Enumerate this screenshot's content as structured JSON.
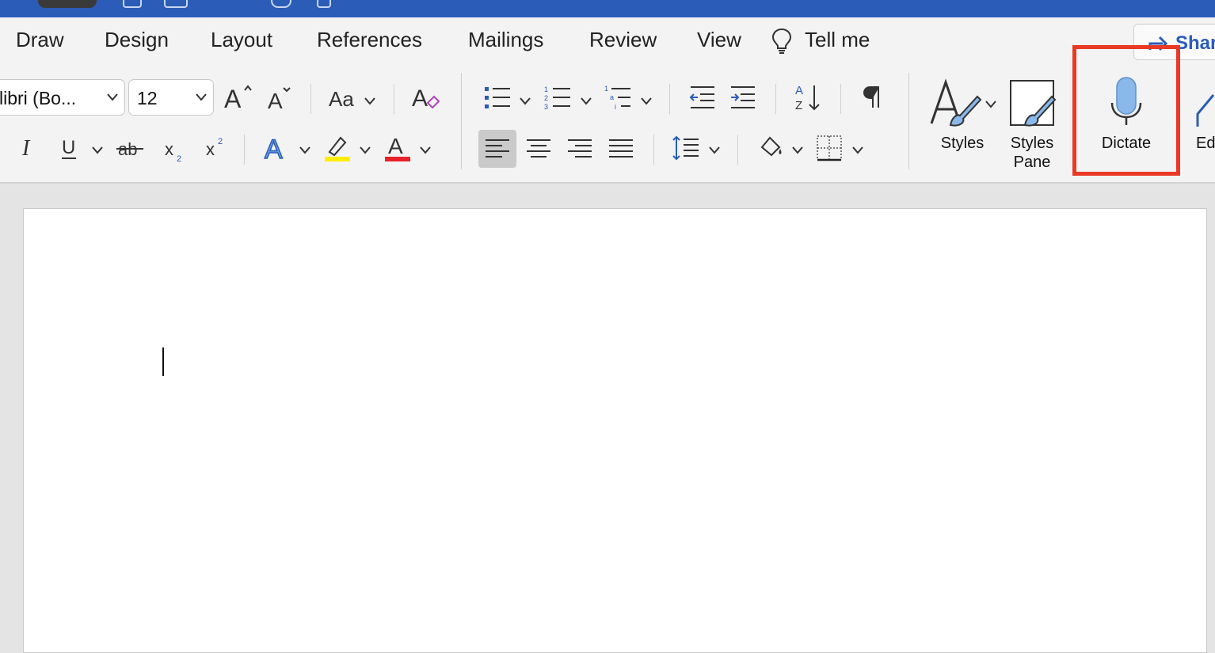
{
  "tabs": [
    "Draw",
    "Design",
    "Layout",
    "References",
    "Mailings",
    "Review",
    "View"
  ],
  "tell_me": {
    "label": "Tell me",
    "icon": "lightbulb-icon"
  },
  "share": {
    "label": "Shar",
    "icon": "share-icon"
  },
  "font": {
    "name": "libri (Bo...",
    "size": "12"
  },
  "buttons": {
    "change_case": "Aa",
    "styles": "Styles",
    "styles_pane": "Styles Pane",
    "dictate": "Dictate",
    "editor": "Ed"
  },
  "icons": {
    "grow_font": "increase-font-size-icon",
    "shrink_font": "decrease-font-size-icon",
    "clear_formatting": "clear-formatting-icon",
    "bullets": "bullet-list-icon",
    "numbering": "numbered-list-icon",
    "multilevel": "multilevel-list-icon",
    "decrease_indent": "decrease-indent-icon",
    "increase_indent": "increase-indent-icon",
    "sort": "sort-icon",
    "show_marks": "paragraph-mark-icon",
    "italic": "italic-icon",
    "underline": "underline-icon",
    "strikethrough": "strikethrough-icon",
    "subscript": "subscript-icon",
    "superscript": "superscript-icon",
    "text_effects": "text-effects-icon",
    "highlight": "highlight-icon",
    "font_color": "font-color-icon",
    "align_left": "align-left-icon",
    "center": "align-center-icon",
    "align_right": "align-right-icon",
    "justify": "justify-icon",
    "line_spacing": "line-spacing-icon",
    "shading": "shading-icon",
    "borders": "borders-icon",
    "microphone": "microphone-icon"
  },
  "colors": {
    "title_bar": "#2b5cb8",
    "highlight_box": "#e83a25",
    "highlight_yellow": "#ffee00",
    "font_red": "#e8212a",
    "mic_blue": "#8ab8ea"
  }
}
